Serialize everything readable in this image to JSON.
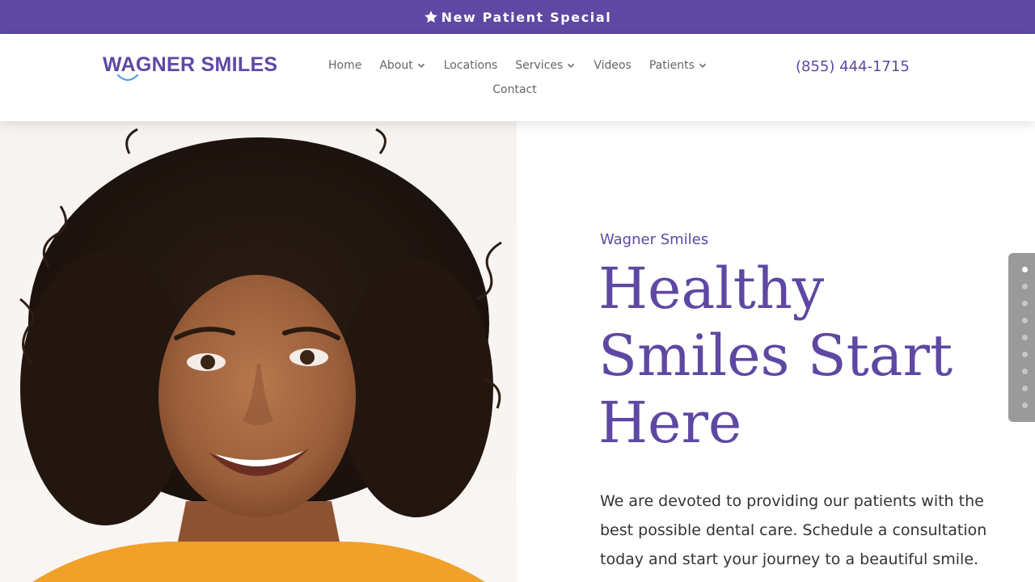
{
  "promo": {
    "label": "New Patient Special",
    "icon": "star-icon"
  },
  "header": {
    "logo_text": "WAGNER SMILES",
    "phone": "(855) 444-1715"
  },
  "nav": {
    "items": [
      {
        "label": "Home",
        "has_dropdown": false
      },
      {
        "label": "About",
        "has_dropdown": true
      },
      {
        "label": "Locations",
        "has_dropdown": false
      },
      {
        "label": "Services",
        "has_dropdown": true
      },
      {
        "label": "Videos",
        "has_dropdown": false
      },
      {
        "label": "Patients",
        "has_dropdown": true
      },
      {
        "label": "Contact",
        "has_dropdown": false
      }
    ]
  },
  "hero": {
    "eyebrow": "Wagner Smiles",
    "headline": "Healthy Smiles Start Here",
    "body": "We are devoted to providing our patients with the best possible dental care. Schedule a consultation today and start your journey to a beautiful smile."
  },
  "dot_nav": {
    "count": 9,
    "active_index": 0
  },
  "colors": {
    "brand": "#5e48a3",
    "nav_text": "#666666",
    "body_text": "#333333",
    "dot_nav_bg": "#9a9a9a"
  }
}
